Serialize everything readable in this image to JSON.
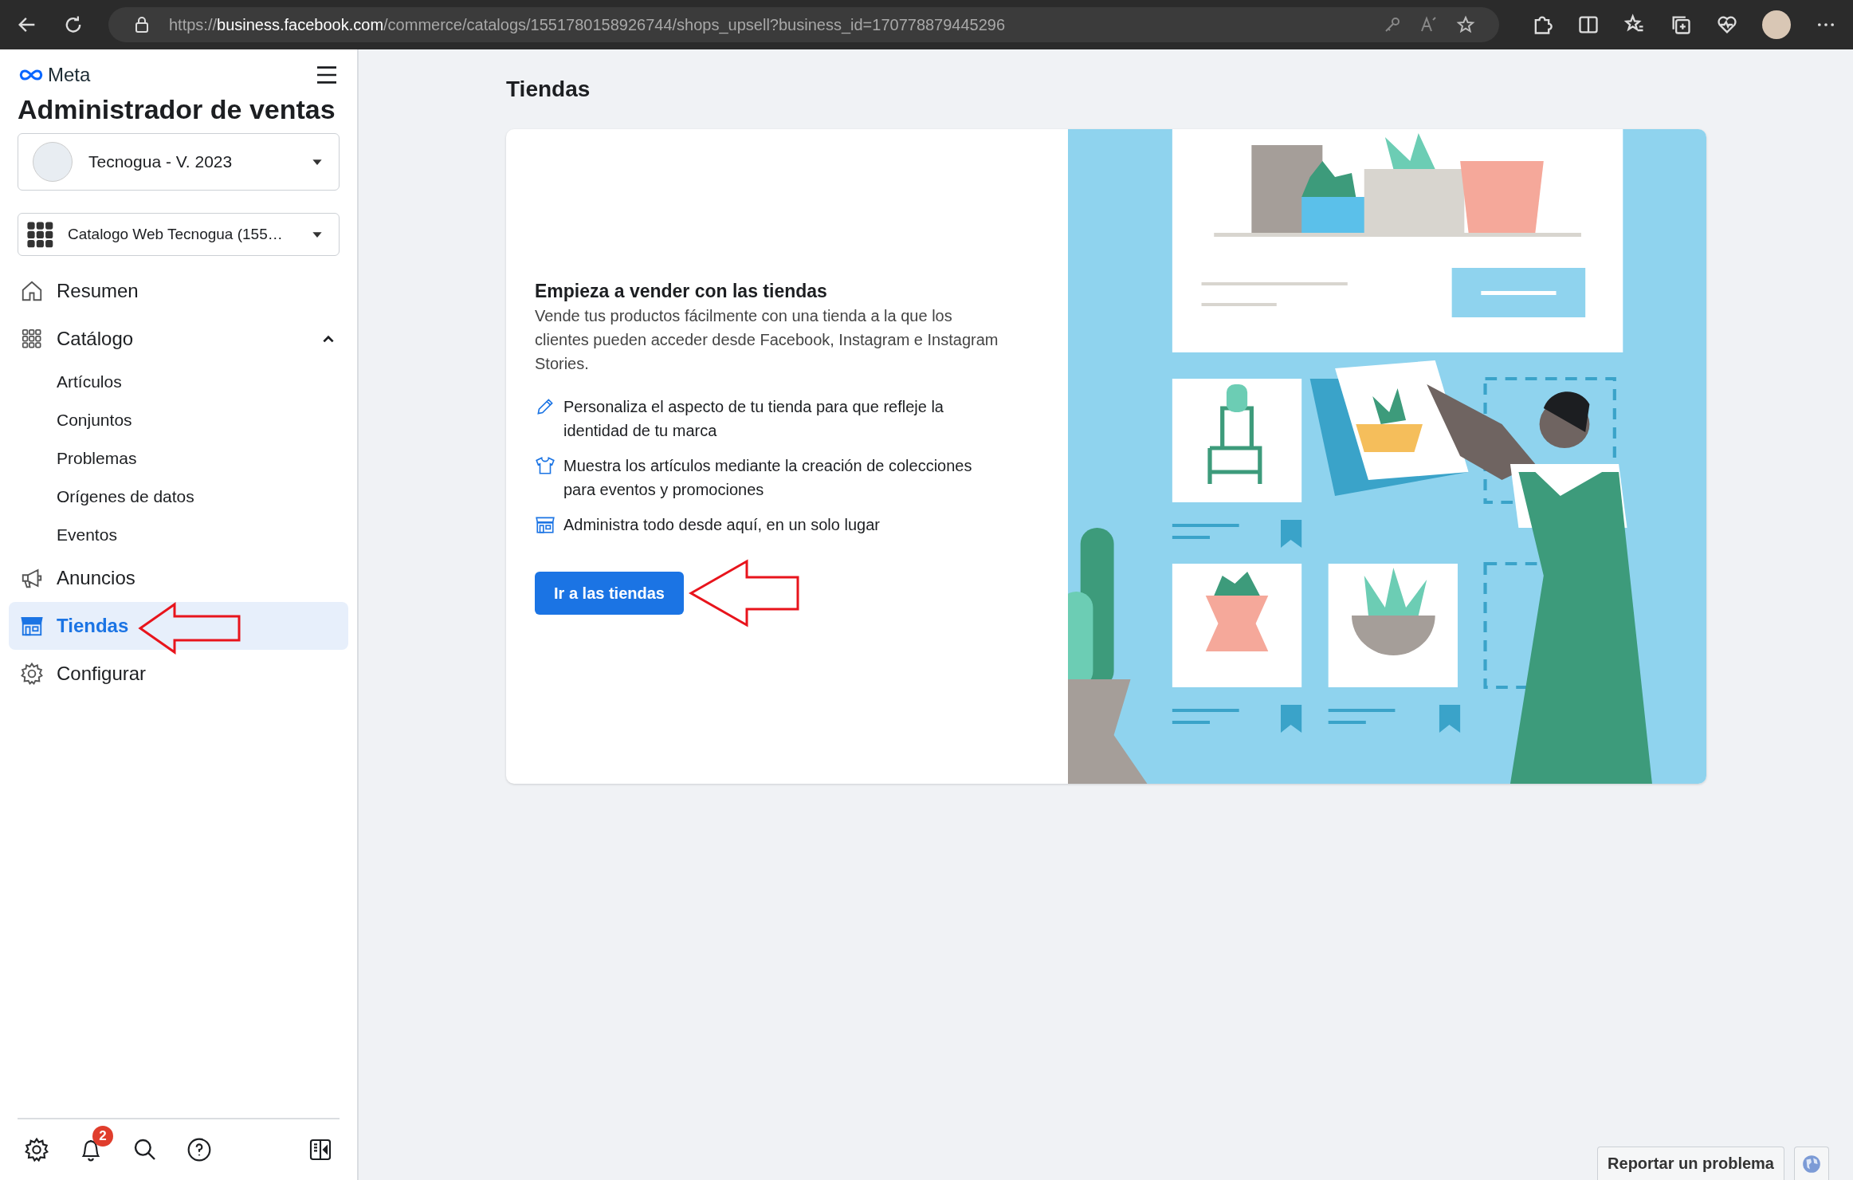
{
  "browser": {
    "url": {
      "scheme": "https://",
      "host": "business.facebook.com",
      "path": "/commerce/catalogs/1551780158926744/shops_upsell?business_id=170778879445296"
    }
  },
  "sidebar": {
    "brand": "Meta",
    "title": "Administrador de ventas",
    "account": {
      "name": "Tecnogua - V. 2023"
    },
    "catalog": {
      "name": "Catalogo Web Tecnogua (155…"
    },
    "items": [
      {
        "label": "Resumen",
        "kind": "home",
        "selected": false
      },
      {
        "label": "Catálogo",
        "kind": "grid",
        "selected": false,
        "expanded": true,
        "children": [
          {
            "label": "Artículos"
          },
          {
            "label": "Conjuntos"
          },
          {
            "label": "Problemas"
          },
          {
            "label": "Orígenes de datos"
          },
          {
            "label": "Eventos"
          }
        ]
      },
      {
        "label": "Anuncios",
        "kind": "megaphone",
        "selected": false
      },
      {
        "label": "Tiendas",
        "kind": "store",
        "selected": true
      },
      {
        "label": "Configurar",
        "kind": "gear",
        "selected": false
      }
    ],
    "footer": {
      "notification_count": "2"
    }
  },
  "main": {
    "title": "Tiendas",
    "card": {
      "heading": "Empieza a vender con las tiendas",
      "description": "Vende tus productos fácilmente con una tienda a la que los clientes pueden acceder desde Facebook, Instagram e Instagram Stories.",
      "features": [
        {
          "kind": "pencil",
          "text": "Personaliza el aspecto de tu tienda para que refleje la identidad de tu marca"
        },
        {
          "kind": "shirt",
          "text": "Muestra los artículos mediante la creación de colecciones para eventos y promociones"
        },
        {
          "kind": "store",
          "text": "Administra todo desde aquí, en un solo lugar"
        }
      ],
      "button": "Ir a las tiendas"
    }
  },
  "report_button": "Reportar un problema"
}
